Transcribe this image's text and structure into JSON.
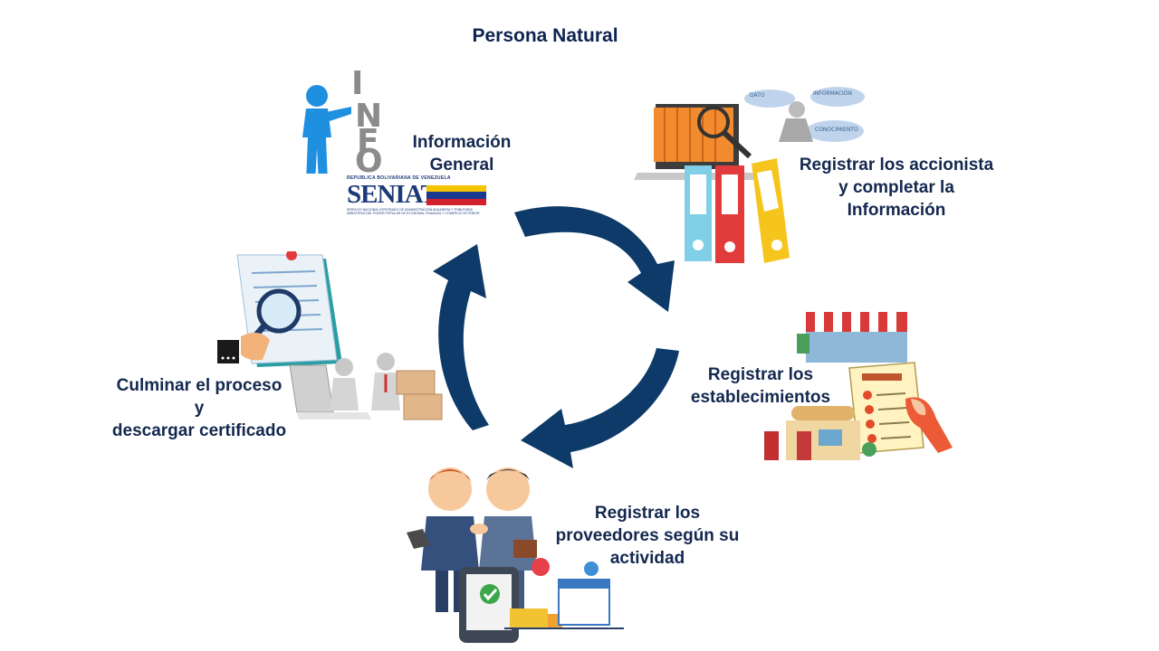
{
  "title": "Persona Natural",
  "steps": [
    {
      "id": "info",
      "label": "Información\nGeneral"
    },
    {
      "id": "accionista",
      "label": "Registrar los accionista\ny completar la\nInformación"
    },
    {
      "id": "establecimientos",
      "label": "Registrar los\nestablecimientos"
    },
    {
      "id": "proveedores",
      "label": "Registrar los\nproveedores según su\nactividad"
    },
    {
      "id": "culminar",
      "label": "Culminar el proceso\ny\ndescargar certificado"
    }
  ],
  "logo": {
    "top_text": "REPUBLICA BOLIVARIANA DE VENEZUELA",
    "brand": "SENIAT",
    "sub1": "SERVICIO NACIONAL INTEGRADO DE ADMINISTRACION ADUANERA Y TRIBUTARIA",
    "sub2": "MINISTERIO DEL PODER POPULAR DE ECONOMIA, FINANZAS Y COMERCIO EXTERIOR"
  },
  "knowledge_clouds": [
    "DATO",
    "INFORMACIÓN",
    "CONOCIMIENTO"
  ],
  "info_letters": [
    "I",
    "N",
    "F",
    "O"
  ],
  "colors": {
    "arrow": "#0d3a68",
    "text": "#14284f",
    "title": "#0e2350"
  }
}
